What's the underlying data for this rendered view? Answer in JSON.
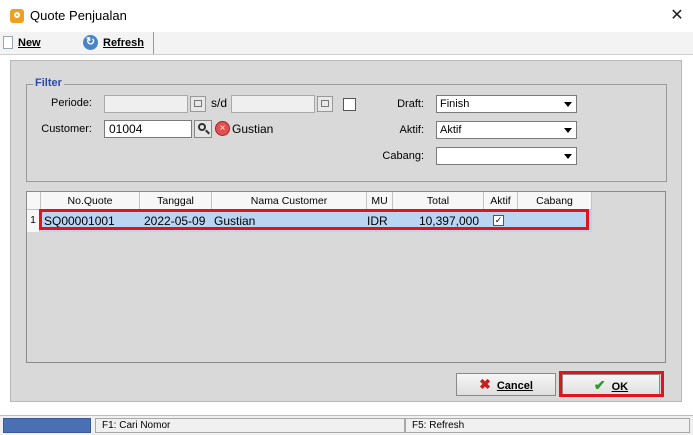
{
  "window": {
    "title": "Quote Penjualan",
    "close_symbol": "✕"
  },
  "toolbar": {
    "new_label": "New",
    "refresh_label": "Refresh",
    "refresh_icon_glyph": "↻"
  },
  "filter": {
    "legend": "Filter",
    "periode_label": "Periode:",
    "periode_from": "",
    "sd_label": "s/d",
    "periode_to": "",
    "customer_label": "Customer:",
    "customer_code": "01004",
    "customer_name": "Gustian",
    "draft_label": "Draft:",
    "draft_value": "Finish",
    "aktif_label": "Aktif:",
    "aktif_value": "Aktif",
    "cabang_label": "Cabang:",
    "cabang_value": ""
  },
  "grid": {
    "columns": [
      "No.Quote",
      "Tanggal",
      "Nama Customer",
      "MU",
      "Total",
      "Aktif",
      "Cabang"
    ],
    "rows": [
      {
        "num": "1",
        "no_quote": "SQ00001001",
        "tanggal": "2022-05-09",
        "nama_customer": "Gustian",
        "mu": "IDR",
        "total": "10,397,000",
        "aktif": true,
        "cabang": ""
      }
    ]
  },
  "buttons": {
    "cancel_label": "Cancel",
    "cancel_glyph": "✖",
    "ok_label": "OK",
    "ok_glyph": "✔"
  },
  "statusbar": {
    "f1_text": "F1: Cari Nomor",
    "f5_text": "F5: Refresh"
  },
  "colors": {
    "highlight": "#e0141b",
    "selected_row": "#b9d5f2",
    "filter_legend": "#2b4aa8"
  }
}
